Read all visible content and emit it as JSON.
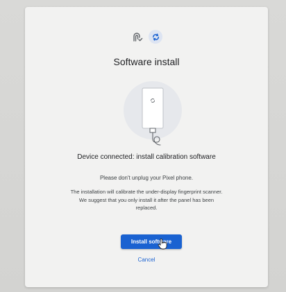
{
  "dialog": {
    "title": "Software install",
    "headline": "Device connected: install calibration software",
    "note": "Please don't unplug your Pixel phone.",
    "description": "The installation will calibrate the under-display fingerprint scanner. We suggest that you only install it after the panel has been replaced."
  },
  "actions": {
    "install_label": "Install software",
    "cancel_label": "Cancel"
  },
  "icons": {
    "header_left": "fingerprint-check-icon",
    "header_right": "sync-icon",
    "illustration": "phone-usb-icon",
    "cursor": "hand-pointer-icon"
  },
  "colors": {
    "primary": "#1a62d1",
    "badge_bg": "#dde4f2",
    "illustration_circle": "#e6e8ec"
  }
}
